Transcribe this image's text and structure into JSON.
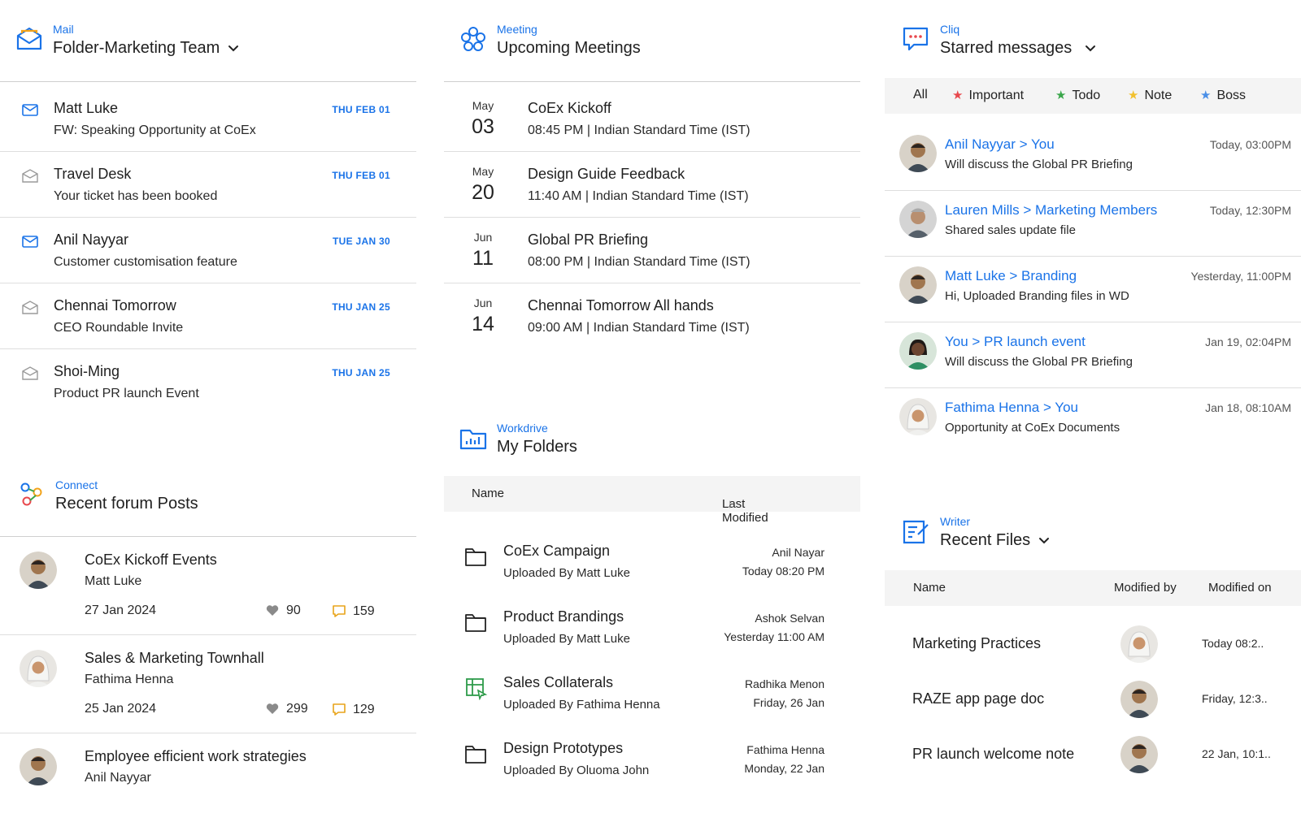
{
  "mail": {
    "app_name": "Mail",
    "title": "Folder-Marketing Team",
    "items": [
      {
        "sender": "Matt Luke",
        "subject": "FW: Speaking Opportunity at CoEx",
        "date": "THU FEB 01",
        "unread": true
      },
      {
        "sender": "Travel Desk",
        "subject": "Your ticket has been booked",
        "date": "THU FEB 01",
        "unread": false
      },
      {
        "sender": "Anil Nayyar",
        "subject": "Customer customisation feature",
        "date": "TUE JAN 30",
        "unread": true
      },
      {
        "sender": "Chennai Tomorrow",
        "subject": "CEO Roundable Invite",
        "date": "THU JAN 25",
        "unread": false
      },
      {
        "sender": "Shoi-Ming",
        "subject": "Product PR launch Event",
        "date": "THU JAN 25",
        "unread": false
      }
    ]
  },
  "meeting": {
    "app_name": "Meeting",
    "title": "Upcoming Meetings",
    "items": [
      {
        "month": "May",
        "day": "03",
        "title": "CoEx Kickoff",
        "time": "08:45 PM | Indian Standard Time (IST)"
      },
      {
        "month": "May",
        "day": "20",
        "title": "Design Guide Feedback",
        "time": "11:40 AM | Indian Standard Time (IST)"
      },
      {
        "month": "Jun",
        "day": "11",
        "title": "Global PR Briefing",
        "time": "08:00 PM | Indian Standard Time (IST)"
      },
      {
        "month": "Jun",
        "day": "14",
        "title": "Chennai Tomorrow All hands",
        "time": "09:00 AM | Indian Standard Time (IST)"
      }
    ]
  },
  "cliq": {
    "app_name": "Cliq",
    "title": "Starred messages",
    "filters": [
      {
        "label": "All",
        "color": ""
      },
      {
        "label": "Important",
        "color": "#e8484d"
      },
      {
        "label": "Todo",
        "color": "#3aa64a"
      },
      {
        "label": "Note",
        "color": "#f2c12e"
      },
      {
        "label": "Boss",
        "color": "#4a8fe7"
      }
    ],
    "items": [
      {
        "who": "Anil Nayyar > You",
        "msg": "Will discuss the Global PR Briefing",
        "time": "Today, 03:00PM"
      },
      {
        "who": "Lauren Mills > Marketing Members",
        "msg": "Shared sales update file",
        "time": "Today, 12:30PM"
      },
      {
        "who": "Matt Luke > Branding",
        "msg": "Hi, Uploaded Branding files in WD",
        "time": "Yesterday, 11:00PM"
      },
      {
        "who": "You > PR launch event",
        "msg": "Will discuss the Global PR Briefing",
        "time": "Jan 19, 02:04PM"
      },
      {
        "who": "Fathima Henna > You",
        "msg": "Opportunity at CoEx Documents",
        "time": "Jan 18, 08:10AM"
      }
    ]
  },
  "connect": {
    "app_name": "Connect",
    "title": "Recent forum Posts",
    "items": [
      {
        "title": "CoEx Kickoff Events",
        "author": "Matt Luke",
        "date": "27 Jan 2024",
        "likes": "90",
        "comments": "159"
      },
      {
        "title": "Sales & Marketing Townhall",
        "author": "Fathima Henna",
        "date": "25 Jan 2024",
        "likes": "299",
        "comments": "129"
      },
      {
        "title": "Employee efficient work strategies",
        "author": "Anil Nayyar",
        "date": "",
        "likes": "",
        "comments": ""
      }
    ]
  },
  "workdrive": {
    "app_name": "Workdrive",
    "title": "My Folders",
    "columns": {
      "name": "Name",
      "modified": "Last Modified"
    },
    "items": [
      {
        "name": "CoEx Campaign",
        "uploaded": "Uploaded By Matt Luke",
        "modified_by": "Anil Nayar",
        "modified_on": "Today 08:20 PM",
        "icon": "folder-icon"
      },
      {
        "name": "Product Brandings",
        "uploaded": "Uploaded By Matt Luke",
        "modified_by": "Ashok Selvan",
        "modified_on": "Yesterday 11:00 AM",
        "icon": "folder-icon"
      },
      {
        "name": "Sales Collaterals",
        "uploaded": "Uploaded By Fathima Henna",
        "modified_by": "Radhika Menon",
        "modified_on": "Friday, 26 Jan",
        "icon": "spreadsheet-icon"
      },
      {
        "name": "Design Prototypes",
        "uploaded": "Uploaded By Oluoma John",
        "modified_by": "Fathima Henna",
        "modified_on": "Monday, 22 Jan",
        "icon": "folder-icon"
      }
    ]
  },
  "writer": {
    "app_name": "Writer",
    "title": "Recent Files",
    "columns": {
      "name": "Name",
      "modified_by": "Modified by",
      "modified_on": "Modified on"
    },
    "items": [
      {
        "name": "Marketing Practices",
        "modified_on": "Today 08:2.."
      },
      {
        "name": "RAZE app page doc",
        "modified_on": "Friday, 12:3.."
      },
      {
        "name": "PR launch welcome note",
        "modified_on": "22 Jan, 10:1.."
      }
    ]
  },
  "colors": {
    "accent": "#1a73e8",
    "divider": "#dedede",
    "header_bg": "#f4f4f4"
  }
}
